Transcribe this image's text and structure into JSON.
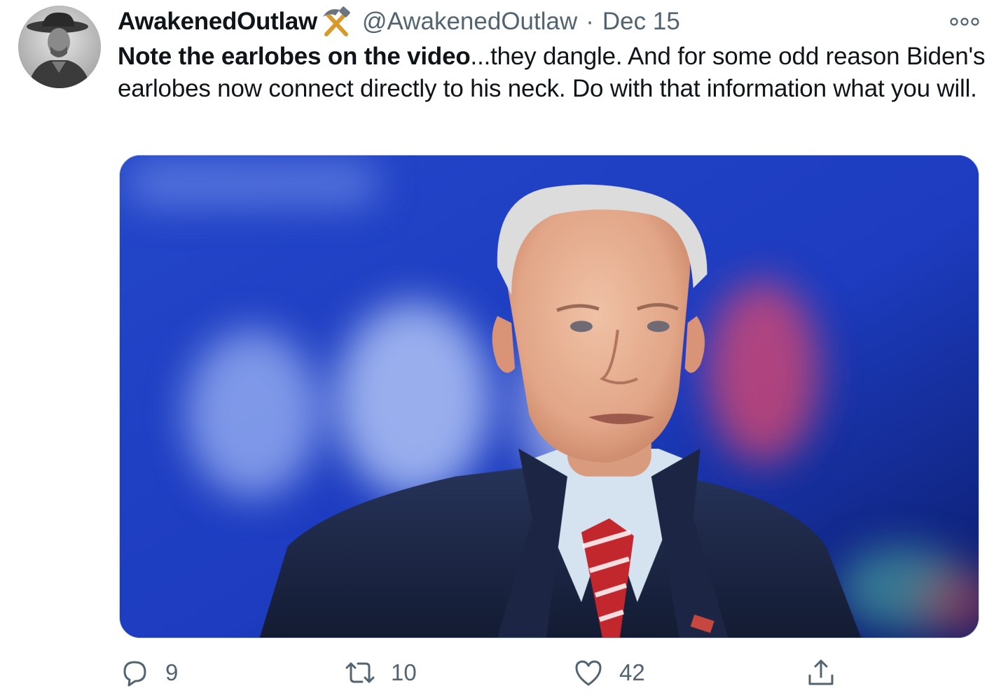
{
  "author": {
    "display_name": "AwakenedOutlaw",
    "name_emoji": "hammer-and-pick-icon",
    "handle": "@AwakenedOutlaw",
    "separator": "·",
    "timestamp": "Dec 15",
    "avatar": "avatar-photo"
  },
  "tweet": {
    "text_bold": "Note the earlobes on the video",
    "text_rest": "...they dangle. And for some odd reason Biden's earlobes now connect directly to his neck.  Do with that information what you will.",
    "media": "attached-photo"
  },
  "more_icon": "more-options-icon",
  "actions": {
    "reply": {
      "icon": "reply-icon",
      "count": "9"
    },
    "retweet": {
      "icon": "retweet-icon",
      "count": "10"
    },
    "like": {
      "icon": "heart-icon",
      "count": "42"
    },
    "share": {
      "icon": "share-icon"
    }
  },
  "colors": {
    "text_primary": "#0f1419",
    "text_secondary": "#536471",
    "media_border": "#cfd9de"
  }
}
